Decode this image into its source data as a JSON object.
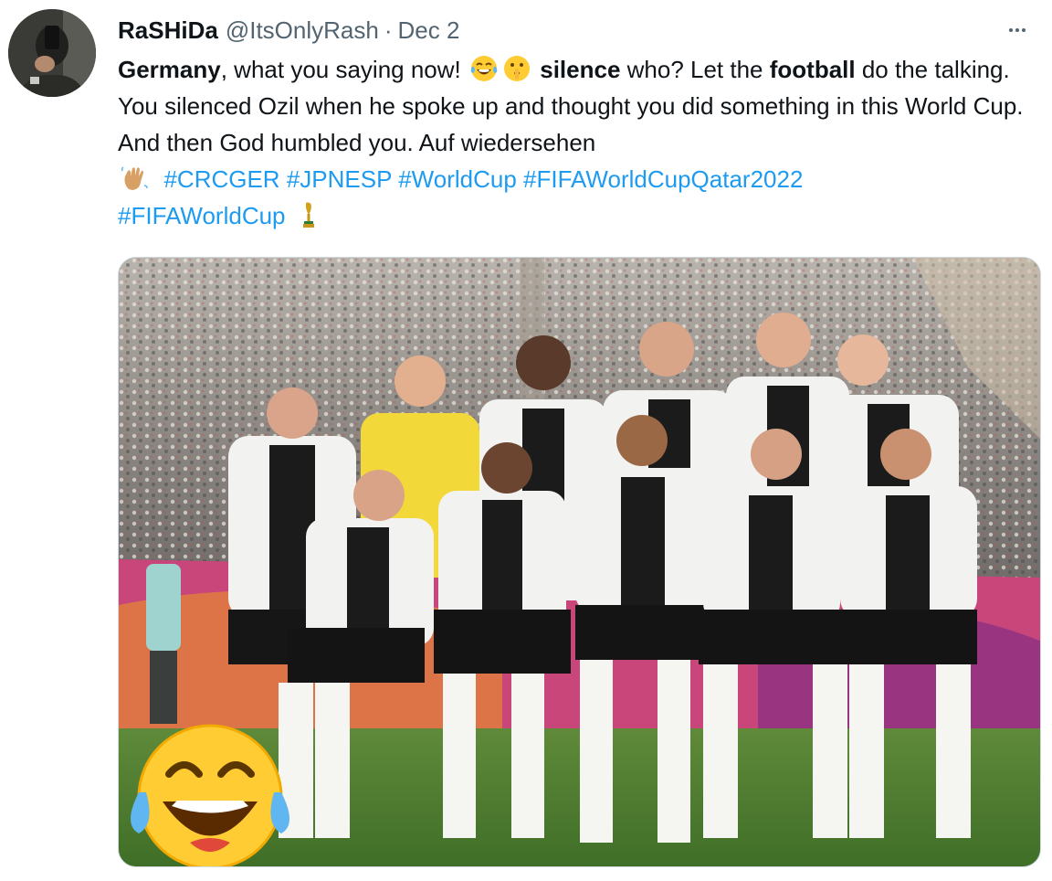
{
  "tweet": {
    "display_name": "RaSHiDa",
    "handle": "@ItsOnlyRash",
    "separator": "·",
    "date": "Dec 2",
    "text": {
      "p1_bold": "Germany",
      "p2": ", what you saying now! ",
      "p3_bold": "silence",
      "p4": " who? Let the ",
      "p5_bold": "football",
      "p6": " do the talking. You silenced Ozil when he spoke up and thought you did something in this World Cup. And then God humbled you. Auf wiedersehen ",
      "hashtags": [
        "#CRCGER",
        "#JPNESP",
        "#WorldCup",
        "#FIFAWorldCupQatar2022",
        "#FIFAWorldCup"
      ]
    },
    "emojis": [
      "face-with-tears-of-joy",
      "shushing-face",
      "waving-hand",
      "trophy"
    ],
    "media": {
      "overlay_emoji": "face-with-tears-of-joy"
    }
  },
  "colors": {
    "link": "#1d9bf0",
    "secondary_text": "#536471",
    "primary_text": "#0f1419"
  }
}
